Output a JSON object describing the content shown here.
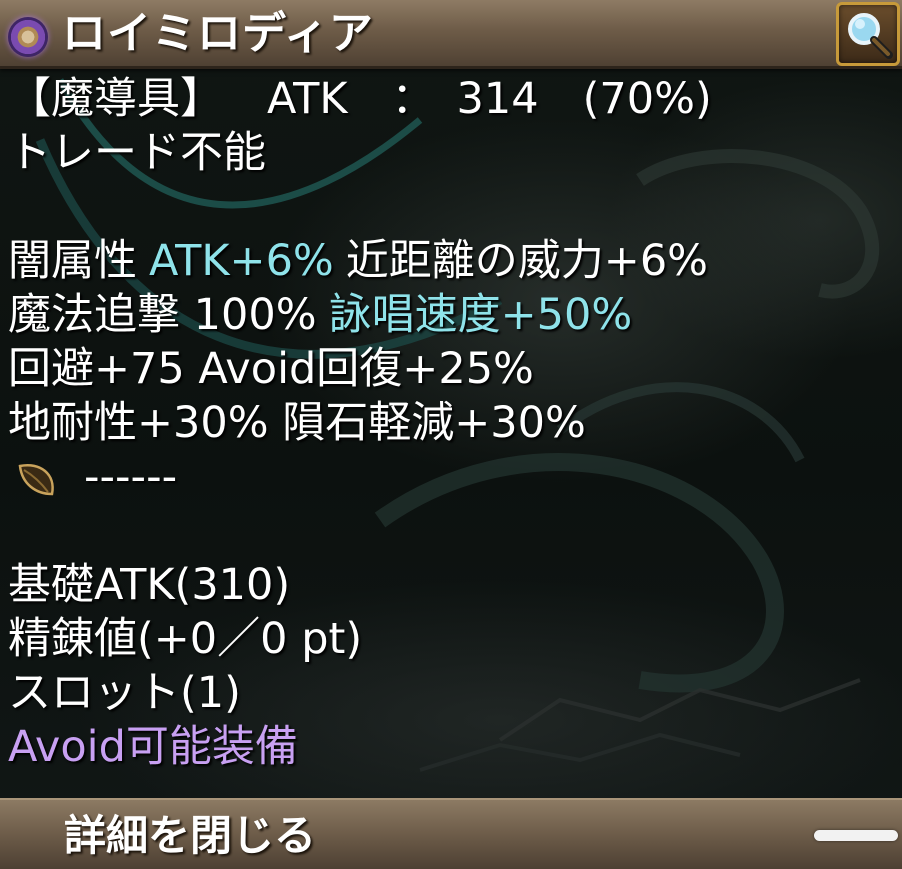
{
  "window": {
    "title": "ロイミロディア",
    "item_icon": "purple-gem-ring-icon",
    "search_icon": "magnifier-icon"
  },
  "stats": {
    "line1": {
      "category": "【魔導具】",
      "atk_label": "ATK",
      "colon": "：",
      "atk_value": "314",
      "percent": "(70%)"
    },
    "line2": "トレード不能",
    "line4": {
      "a": "闇属性",
      "b": "ATK+6%",
      "c": "近距離の威力+6%"
    },
    "line5": {
      "a": "魔法追撃 100%",
      "b": "詠唱速度+50%"
    },
    "line6": "回避+75 Avoid回復+25%",
    "line7": "地耐性+30% 隕石軽減+30%",
    "line8": {
      "icon": "leaf-seed-icon",
      "dashes": "------"
    },
    "line10": "基礎ATK(310)",
    "line11": "精錬値(+0／0 pt)",
    "line12": "スロット(1)",
    "line13": "Avoid可能装備"
  },
  "footer": {
    "close_label": "詳細を閉じる"
  },
  "colors": {
    "cyan": "#8fe3ea",
    "purple": "#c8a0f2",
    "bar": "#6e5c48",
    "frame_gold": "#c79a3a"
  }
}
